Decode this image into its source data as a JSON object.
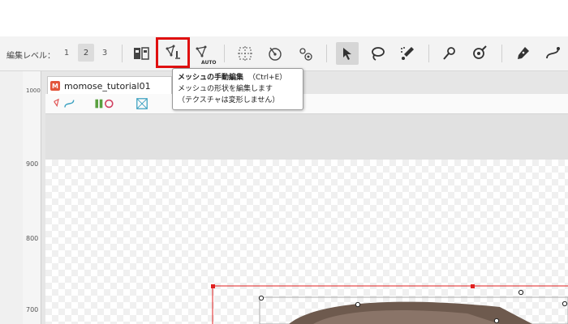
{
  "toolbar": {
    "edit_level_label": "編集レベル：",
    "levels": [
      "1",
      "2",
      "3"
    ],
    "active_level": "2",
    "auto_label": "AUTO",
    "accent_color": "#e01010"
  },
  "tooltip": {
    "title": "メッシュの手動編集",
    "shortcut": "（Ctrl+E）",
    "line1": "メッシュの形状を編集します",
    "line2": "（テクスチャは変形しません）"
  },
  "document": {
    "tab_label": "momose_tutorial01",
    "tab_icon_glyph": "M"
  },
  "ruler": {
    "ticks": [
      "1000",
      "900",
      "800",
      "700"
    ]
  },
  "icons": {
    "toolbar": [
      "deformer-view-icon",
      "mesh-manual-edit-icon",
      "mesh-auto-edit-icon",
      "warp-deformer-icon",
      "rotation-deformer-icon",
      "glue-icon",
      "arrow-select-icon",
      "lasso-select-icon",
      "brush-select-icon",
      "pin-icon",
      "pin-brush-icon",
      "pen-icon",
      "bezier-icon"
    ]
  }
}
